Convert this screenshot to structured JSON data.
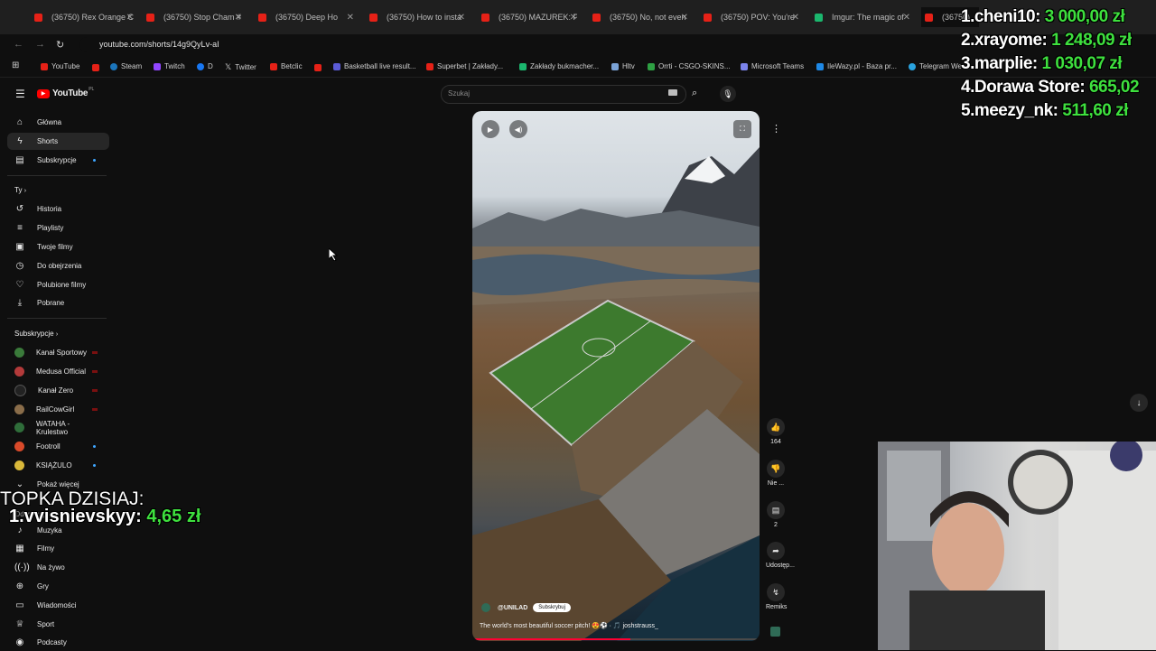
{
  "browser": {
    "tabs": [
      {
        "label": "(36750) Rex Orange C",
        "color": "#e62117"
      },
      {
        "label": "(36750) Stop Cham #",
        "color": "#e62117"
      },
      {
        "label": "(36750) Deep Ho",
        "color": "#e62117"
      },
      {
        "label": "(36750) How to insta",
        "color": "#e62117"
      },
      {
        "label": "(36750) MAZUREK: P",
        "color": "#e62117"
      },
      {
        "label": "(36750) No, not even",
        "color": "#e62117"
      },
      {
        "label": "(36750) POV: You're",
        "color": "#e62117"
      },
      {
        "label": "Imgur: The magic of",
        "color": "#1bb76e"
      },
      {
        "label": "(36750)",
        "color": "#e62117"
      }
    ],
    "url": "youtube.com/shorts/14g9QyLv-aI",
    "bookmarks": [
      {
        "label": "YouTube",
        "color": "#e62117"
      },
      {
        "label": "Steam",
        "color": "#1b75bb"
      },
      {
        "label": "Twitch",
        "color": "#9146ff"
      },
      {
        "label": "D",
        "color": "#1877f2"
      },
      {
        "label": "Twitter",
        "color": "#cccccc"
      },
      {
        "label": "Betclic",
        "color": "#e62117"
      },
      {
        "label": "Basketball live result...",
        "color": "#5b5bd6"
      },
      {
        "label": "Superbet | Zakłady...",
        "color": "#e62117"
      },
      {
        "label": "Zakłady bukmacher...",
        "color": "#1bb76e"
      },
      {
        "label": "Hltv",
        "color": "#7aa2d6"
      },
      {
        "label": "Orrti - CSGO-SKINS...",
        "color": "#2ea043"
      },
      {
        "label": "Microsoft Teams",
        "color": "#7b83eb"
      },
      {
        "label": "IleWazy.pl - Baza pr...",
        "color": "#1e88e5"
      },
      {
        "label": "Telegram We",
        "color": "#2aa3df"
      }
    ]
  },
  "youtube": {
    "logo": "YouTube",
    "logo_sup": "PL",
    "search_placeholder": "Szukaj",
    "nav": [
      {
        "label": "Główna",
        "icon": "home-icon"
      },
      {
        "label": "Shorts",
        "icon": "shorts-icon"
      },
      {
        "label": "Subskrypcje",
        "icon": "subscriptions-icon"
      }
    ],
    "you_section": "Ty",
    "you_items": [
      {
        "label": "Historia",
        "icon": "history-icon"
      },
      {
        "label": "Playlisty",
        "icon": "playlist-icon"
      },
      {
        "label": "Twoje filmy",
        "icon": "your-videos-icon"
      },
      {
        "label": "Do obejrzenia",
        "icon": "watch-later-icon"
      },
      {
        "label": "Polubione filmy",
        "icon": "liked-icon"
      },
      {
        "label": "Pobrane",
        "icon": "download-icon"
      }
    ],
    "subscriptions_title": "Subskrypcje",
    "subscriptions": [
      {
        "label": "Kanał Sportowy",
        "color": "#3a7a3a",
        "badge": "live"
      },
      {
        "label": "Medusa Official",
        "color": "#b33a3a",
        "badge": "live"
      },
      {
        "label": "Kanał Zero",
        "color": "#222222",
        "badge": "live"
      },
      {
        "label": "RailCowGirl",
        "color": "#8a6d4a",
        "badge": "live"
      },
      {
        "label": "WATAHA - Krulestwo",
        "color": "#2f6d3a",
        "badge": "dot"
      },
      {
        "label": "Footroll",
        "color": "#d94a2a",
        "badge": "dot"
      },
      {
        "label": "KSIĄŻULO",
        "color": "#d9b83a",
        "badge": "dot"
      }
    ],
    "show_more": "Pokaż więcej",
    "explore_title": "Odkrywaj",
    "explore": [
      {
        "label": "Muzyka",
        "icon": "music-icon"
      },
      {
        "label": "Filmy",
        "icon": "film-icon"
      },
      {
        "label": "Na żywo",
        "icon": "live-icon"
      },
      {
        "label": "Gry",
        "icon": "gaming-icon"
      },
      {
        "label": "Wiadomości",
        "icon": "news-icon"
      },
      {
        "label": "Sport",
        "icon": "sport-icon"
      },
      {
        "label": "Podcasty",
        "icon": "podcast-icon"
      }
    ],
    "short": {
      "channel": "@UNILAD",
      "subscribe": "Subskrybuj",
      "caption": "The world's most beautiful soccer pitch! 😍⚽ · 🎵 joshstrauss_",
      "actions": [
        {
          "icon": "like-icon",
          "label": "164"
        },
        {
          "icon": "dislike-icon",
          "label": "Nie ..."
        },
        {
          "icon": "comment-icon",
          "label": "2"
        },
        {
          "icon": "share-icon",
          "label": "Udostęp..."
        },
        {
          "icon": "remix-icon",
          "label": "Remiks"
        }
      ]
    }
  },
  "overlay": {
    "leaderboard": [
      {
        "name": "1.cheni10:",
        "amount": "3 000,00 zł"
      },
      {
        "name": "2.xrayome:",
        "amount": "1 248,09 zł"
      },
      {
        "name": "3.marplie:",
        "amount": "1 030,07 zł"
      },
      {
        "name": "4.Dorawa Store:",
        "amount": "665,02"
      },
      {
        "name": "5.meezy_nk:",
        "amount": "511,60 zł"
      }
    ],
    "topka_title": "TOPKA DZISIAJ:",
    "topka_name": "1.vvisnievskyy:",
    "topka_amount": "4,65 zł"
  }
}
